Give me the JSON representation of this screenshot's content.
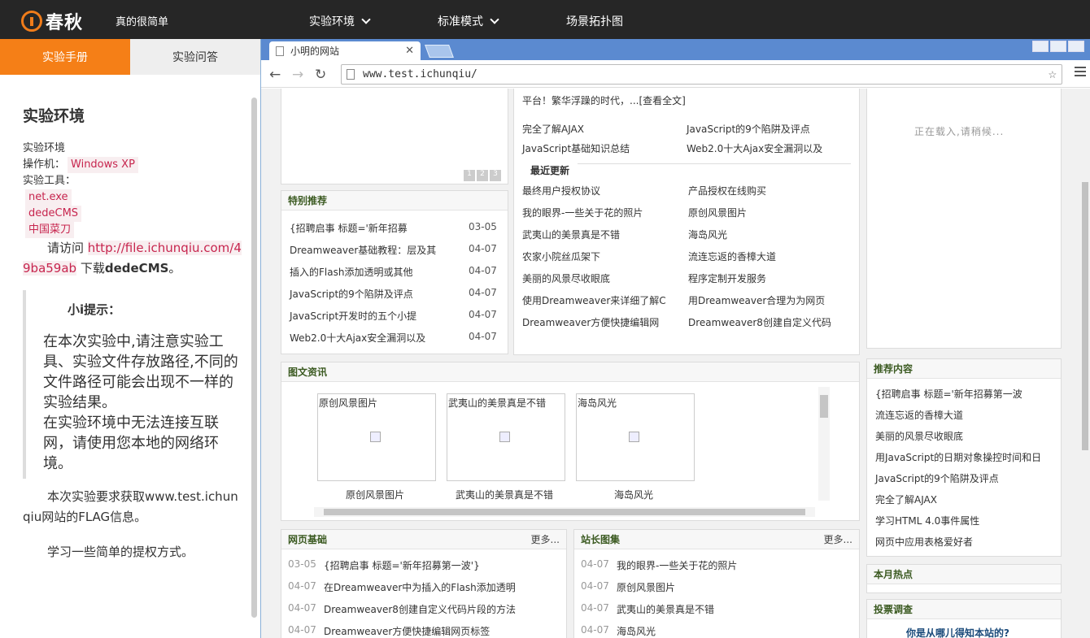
{
  "topbar": {
    "logo_text": "春秋",
    "slogan": "真的很简单",
    "nav": [
      "实验环境",
      "标准模式",
      "场景拓扑图"
    ]
  },
  "left_panel": {
    "tabs": [
      "实验手册",
      "实验问答"
    ],
    "title": "实验环境",
    "env_label": "实验环境",
    "os_label": "操作机：",
    "os_value": "Windows XP",
    "tools_label": "实验工具：",
    "tools": [
      "net.exe",
      "dedeCMS",
      "中国菜刀"
    ],
    "visit_prefix": "请访问",
    "visit_link": "http://file.ichunqiu.com/49ba59ab",
    "visit_suffix_1": "下载",
    "visit_suffix_bold": "dedeCMS",
    "visit_suffix_2": "。",
    "tip_head": "小i提示：",
    "tip_text_1": "在本次实验中,请注意实验工具、实验文件存放路径,不同的文件路径可能会出现不一样的实验结果。",
    "tip_text_2": "在实验环境中无法连接互联网，请使用您本地的网络环境。",
    "goal_text": "本次实验要求获取www.test.ichunqiu网站的FLAG信息。",
    "learn_text": "学习一些简单的提权方式。"
  },
  "browser": {
    "tab_title": "小明的网站",
    "url": "www.test.ichunqiu/"
  },
  "site": {
    "intro_tail": "平台！繁华浮躁的时代，...[查看全文]",
    "mid_top_links": [
      "完全了解AJAX",
      "JavaScript的9个陷阱及评点",
      "JavaScript基础知识总结",
      "Web2.0十大Ajax安全漏洞以及"
    ],
    "recent_title": "最近更新",
    "recent_left": [
      "最终用户授权协议",
      "我的眼界-一些关于花的照片",
      "武夷山的美景真是不错",
      "农家小院丝瓜架下",
      "美丽的风景尽收眼底",
      "使用Dreamweaver来详细了解C",
      "Dreamweaver方便快捷编辑网"
    ],
    "recent_right": [
      "产品授权在线购买",
      "原创风景图片",
      "海岛风光",
      "流连忘返的香樟大道",
      "程序定制开发服务",
      "用Dreamweaver合理为为网页",
      "Dreamweaver8创建自定义代码"
    ],
    "loading_text": "正在载入,请稍候...",
    "slider_pages": [
      "1",
      "2",
      "3"
    ],
    "special_title": "特别推荐",
    "special": [
      {
        "t": "{招聘启事 标题='新年招募",
        "d": "03-05"
      },
      {
        "t": "Dreamweaver基础教程：层及其",
        "d": "04-07"
      },
      {
        "t": "插入的Flash添加透明或其他",
        "d": "04-07"
      },
      {
        "t": "JavaScript的9个陷阱及评点",
        "d": "04-07"
      },
      {
        "t": "JavaScript开发时的五个小提",
        "d": "04-07"
      },
      {
        "t": "Web2.0十大Ajax安全漏洞以及",
        "d": "04-07"
      }
    ],
    "gallery_title": "图文资讯",
    "gallery": [
      "原创风景图片",
      "武夷山的美景真是不错",
      "海岛风光"
    ],
    "recommend_title": "推荐内容",
    "recommend": [
      "{招聘启事 标题='新年招募第一波",
      "流连忘返的香樟大道",
      "美丽的风景尽收眼底",
      "用JavaScript的日期对象操控时间和日",
      "JavaScript的9个陷阱及评点",
      "完全了解AJAX",
      "学习HTML 4.0事件属性",
      "网页中应用表格爱好者"
    ],
    "web_basic_title": "网页基础",
    "web_basic": [
      {
        "d": "03-05",
        "t": "{招聘启事 标题='新年招募第一波'}"
      },
      {
        "d": "04-07",
        "t": "在Dreamweaver中为插入的Flash添加透明"
      },
      {
        "d": "04-07",
        "t": "Dreamweaver8创建自定义代码片段的方法"
      },
      {
        "d": "04-07",
        "t": "Dreamweaver方便快捷编辑网页标签"
      }
    ],
    "gallery2_title": "站长图集",
    "gallery2": [
      {
        "d": "04-07",
        "t": "我的眼界-一些关于花的照片"
      },
      {
        "d": "04-07",
        "t": "原创风景图片"
      },
      {
        "d": "04-07",
        "t": "武夷山的美景真是不错"
      },
      {
        "d": "04-07",
        "t": "海岛风光"
      }
    ],
    "more_label": "更多...",
    "hot_title": "本月热点",
    "vote_title": "投票调查",
    "vote_question": "你是从哪儿得知本站的?"
  }
}
